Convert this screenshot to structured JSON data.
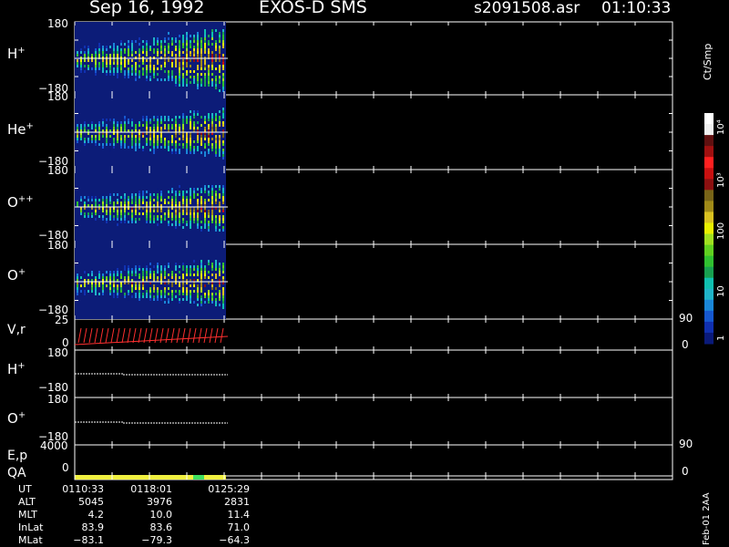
{
  "header": {
    "date": "Sep 16, 1992",
    "instrument": "EXOS-D SMS",
    "file": "s2091508.asr",
    "time": "01:10:33"
  },
  "colorbar": {
    "title": "Ct/Smp",
    "tick_labels": [
      "1",
      "10",
      "100",
      "10³",
      "10⁴"
    ],
    "colors": [
      "#0a1a7a",
      "#1030b0",
      "#1658d0",
      "#1a86d8",
      "#20b4c8",
      "#10c0b0",
      "#18a050",
      "#30c030",
      "#60d020",
      "#a0e020",
      "#e8f000",
      "#d8c020",
      "#a08a18",
      "#786418",
      "#8c1010",
      "#c81010",
      "#ff2020",
      "#a01010",
      "#601010",
      "#f0f0f0",
      "#ffffff"
    ]
  },
  "panels": {
    "h_plus": {
      "label": "H",
      "sup": "+",
      "ymax": "180",
      "ymin": "−180"
    },
    "he_plus": {
      "label": "He",
      "sup": "+",
      "ymax": "180",
      "ymin": "−180"
    },
    "o_pp": {
      "label": "O",
      "sup": "++",
      "ymax": "180",
      "ymin": "−180"
    },
    "o_plus": {
      "label": "O",
      "sup": "+",
      "ymax": "180",
      "ymin": "−180"
    },
    "vr": {
      "label": "V,r",
      "ymax": "25",
      "ymin": "0",
      "rmax": "90",
      "rmin": "0"
    },
    "h_plus2": {
      "label": "H",
      "sup": "+",
      "ymax": "180",
      "ymin": "−180"
    },
    "o_plus2": {
      "label": "O",
      "sup": "+",
      "ymax": "180",
      "ymin": "−180"
    },
    "ep": {
      "label": "E,p",
      "ymax": "4000",
      "ymin": "0",
      "rmax": "90"
    },
    "qa": {
      "label": "QA",
      "ymin": "0",
      "rmin": "0"
    }
  },
  "footer": {
    "sidebar": "Feb-01 2AA",
    "rows": [
      {
        "label": "UT",
        "values": [
          "0110:33",
          "0118:01",
          "0125:29"
        ]
      },
      {
        "label": "ALT",
        "values": [
          "5045",
          "3976",
          "2831"
        ]
      },
      {
        "label": "MLT",
        "values": [
          "4.2",
          "10.0",
          "11.4"
        ]
      },
      {
        "label": "InLat",
        "values": [
          "83.9",
          "83.6",
          "71.0"
        ]
      },
      {
        "label": "MLat",
        "values": [
          "−83.1",
          "−79.3",
          "−64.3"
        ]
      }
    ]
  },
  "chart_data": {
    "type": "heatmap",
    "title": "Sep 16, 1992 EXOS-D SMS s2091508.asr 01:10:33",
    "x_axis": {
      "label": "UT",
      "ticks": [
        "0110:33",
        "0118:01",
        "0125:29"
      ],
      "data_coverage_end": "0125:29"
    },
    "colorbar": {
      "label": "Ct/Smp",
      "scale": "log",
      "range": [
        1,
        10000
      ]
    },
    "spectrogram_panels": [
      {
        "species": "H+",
        "ylim": [
          -180,
          180
        ]
      },
      {
        "species": "He+",
        "ylim": [
          -180,
          180
        ]
      },
      {
        "species": "O++",
        "ylim": [
          -180,
          180
        ]
      },
      {
        "species": "O+",
        "ylim": [
          -180,
          180
        ]
      }
    ],
    "line_panels": [
      {
        "name": "V,r",
        "ylim": [
          0,
          25
        ],
        "right_ylim": [
          0,
          90
        ]
      },
      {
        "name": "H+",
        "ylim": [
          -180,
          180
        ]
      },
      {
        "name": "O+",
        "ylim": [
          -180,
          180
        ]
      },
      {
        "name": "E,p",
        "ylim": [
          0,
          4000
        ],
        "right_ylim": [
          0,
          90
        ]
      },
      {
        "name": "QA",
        "ylim": [
          0,
          1
        ],
        "right_ylim": [
          0,
          1
        ]
      }
    ]
  }
}
